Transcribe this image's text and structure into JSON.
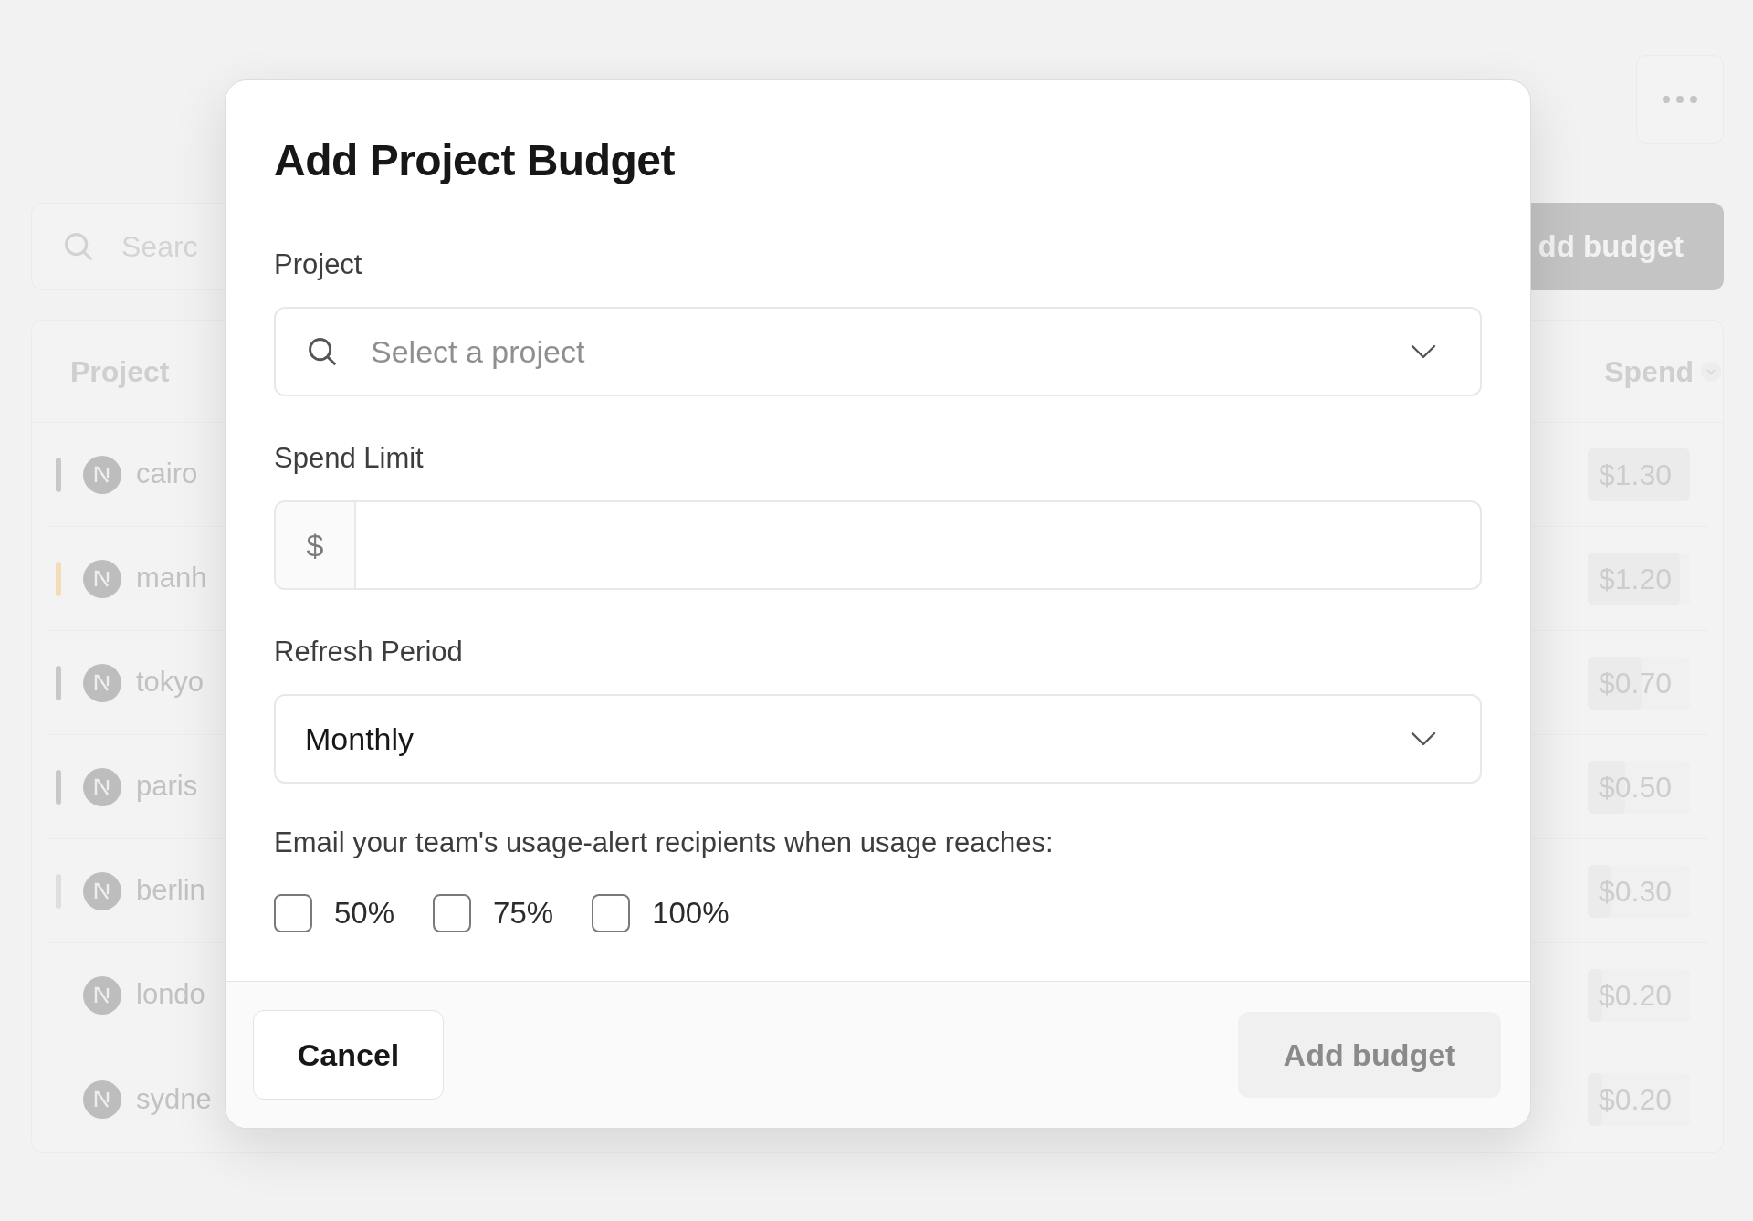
{
  "page": {
    "search": {
      "placeholder": "Searc"
    },
    "add_button": "dd budget",
    "table": {
      "columns": [
        "Project",
        "Spend"
      ],
      "rows": [
        {
          "name": "cairo",
          "color": "#c8c8c8",
          "spend": "$1.30",
          "level": 1
        },
        {
          "name": "manh",
          "color": "#f3dcb6",
          "spend": "$1.20",
          "level": 0.9
        },
        {
          "name": "tokyo",
          "color": "#c8c8c8",
          "spend": "$0.70",
          "level": 0.53
        },
        {
          "name": "paris",
          "color": "#c8c8c8",
          "spend": "$0.50",
          "level": 0.37
        },
        {
          "name": "berlin",
          "color": "#dedede",
          "spend": "$0.30",
          "level": 0.22
        },
        {
          "name": "londo",
          "spend": "$0.20",
          "level": 0.14
        },
        {
          "name": "sydne",
          "spend": "$0.20",
          "level": 0.14
        }
      ]
    }
  },
  "dialog": {
    "title": "Add Project Budget",
    "fields": [
      {
        "kind": "search-select",
        "label": "Project",
        "placeholder": "Select a project"
      },
      {
        "kind": "currency",
        "label": "Spend Limit",
        "prefix": "$"
      },
      {
        "kind": "select",
        "label": "Refresh Period",
        "value": "Monthly"
      }
    ],
    "alert_label": "Email your team's usage-alert recipients when usage reaches:",
    "thresholds": [
      {
        "label": "50%",
        "checked": false
      },
      {
        "label": "75%",
        "checked": false
      },
      {
        "label": "100%",
        "checked": false
      }
    ],
    "cancel": "Cancel",
    "submit": {
      "label": "Add budget",
      "disabled": true
    }
  }
}
